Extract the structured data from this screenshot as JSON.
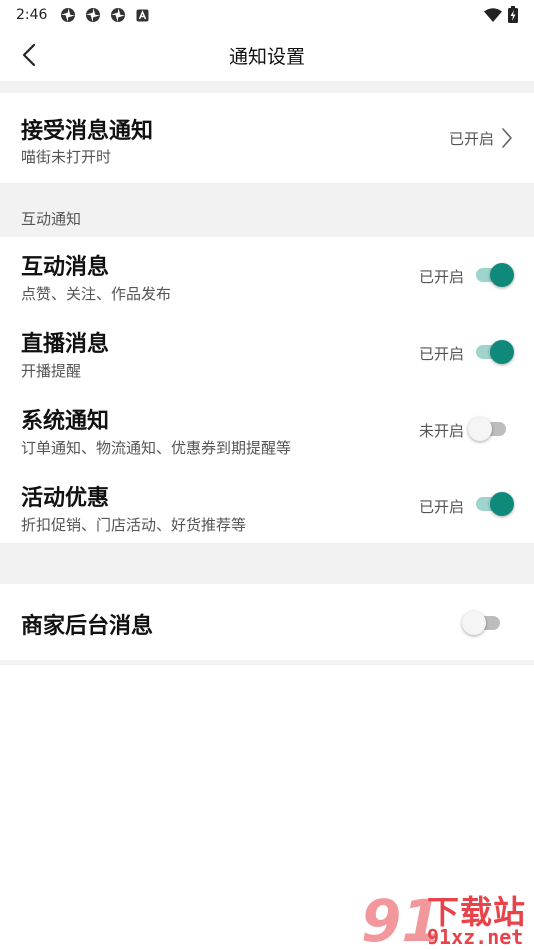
{
  "status_bar": {
    "time": "2:46",
    "icons": [
      "photos-app-icon",
      "photos-app-icon",
      "photos-app-icon",
      "a-notification-icon"
    ],
    "wifi": "wifi-icon",
    "battery": "battery-charging-icon"
  },
  "nav": {
    "back_icon": "chevron-left-icon",
    "title": "通知设置"
  },
  "receive": {
    "title": "接受消息通知",
    "subtitle": "喵街未打开时",
    "state": "已开启"
  },
  "section": {
    "label": "互动通知"
  },
  "items": [
    {
      "title": "互动消息",
      "subtitle": "点赞、关注、作品发布",
      "state": "已开启",
      "enabled": true
    },
    {
      "title": "直播消息",
      "subtitle": "开播提醒",
      "state": "已开启",
      "enabled": true
    },
    {
      "title": "系统通知",
      "subtitle": "订单通知、物流通知、优惠券到期提醒等",
      "state": "未开启",
      "enabled": false
    },
    {
      "title": "活动优惠",
      "subtitle": "折扣促销、门店活动、好货推荐等",
      "state": "已开启",
      "enabled": true
    }
  ],
  "merchant": {
    "title": "商家后台消息",
    "enabled": false
  },
  "watermark": {
    "text": "下载站",
    "domain": "91xz.net",
    "logo_text": "91"
  },
  "colors": {
    "accent": "#0f8a7a",
    "accent_track": "#9fd4cc",
    "background_gap": "#f2f2f2",
    "watermark_red": "#e8434b"
  }
}
